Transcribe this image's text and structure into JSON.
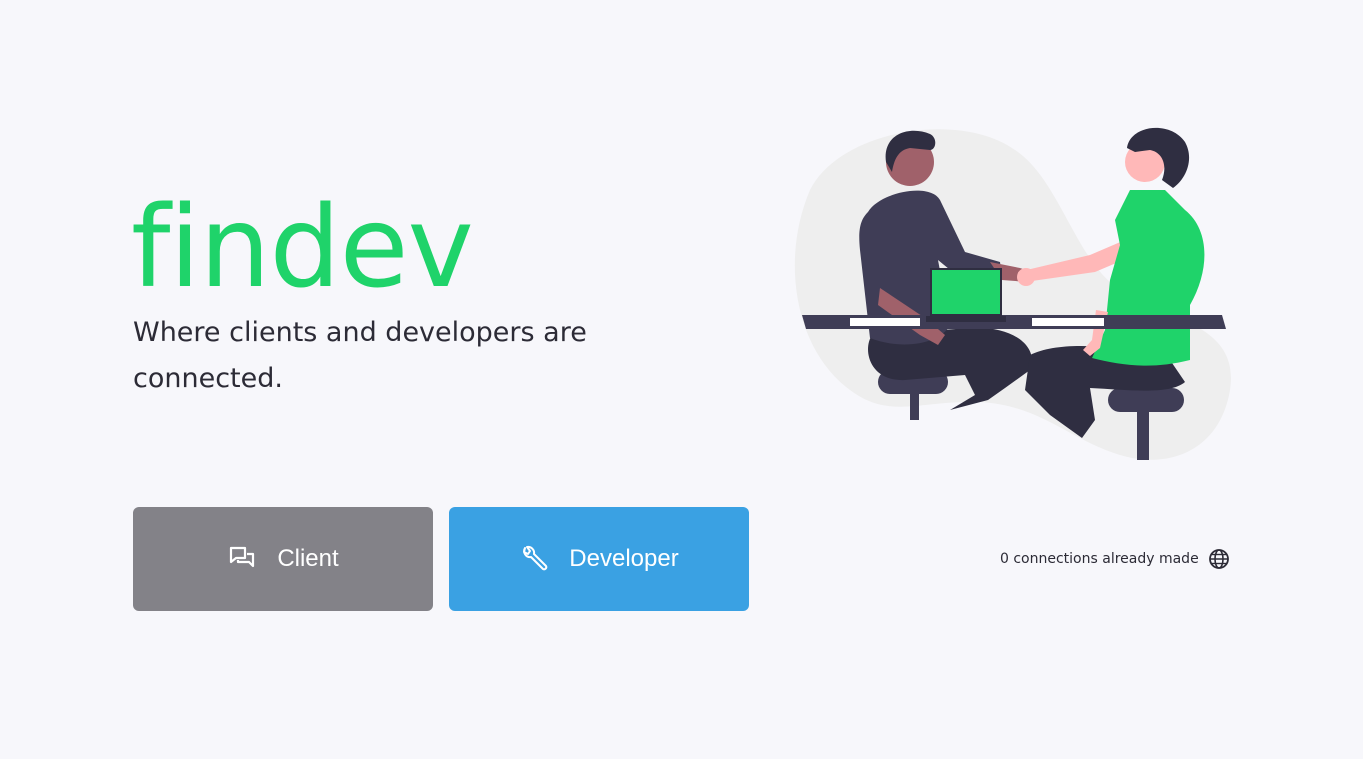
{
  "brand": {
    "name": "findev",
    "tagline": "Where clients and developers are connected."
  },
  "actions": {
    "client_label": "Client",
    "developer_label": "Developer"
  },
  "stats": {
    "connections_text": "0 connections already made"
  },
  "icons": {
    "client": "chat-bubbles-icon",
    "developer": "wrench-icon",
    "connections": "globe-icon"
  },
  "colors": {
    "background": "#f7f7fb",
    "brand_green": "#1fd36a",
    "client_button": "#838288",
    "developer_button": "#3aa1e3",
    "text_dark": "#2c2b36"
  }
}
